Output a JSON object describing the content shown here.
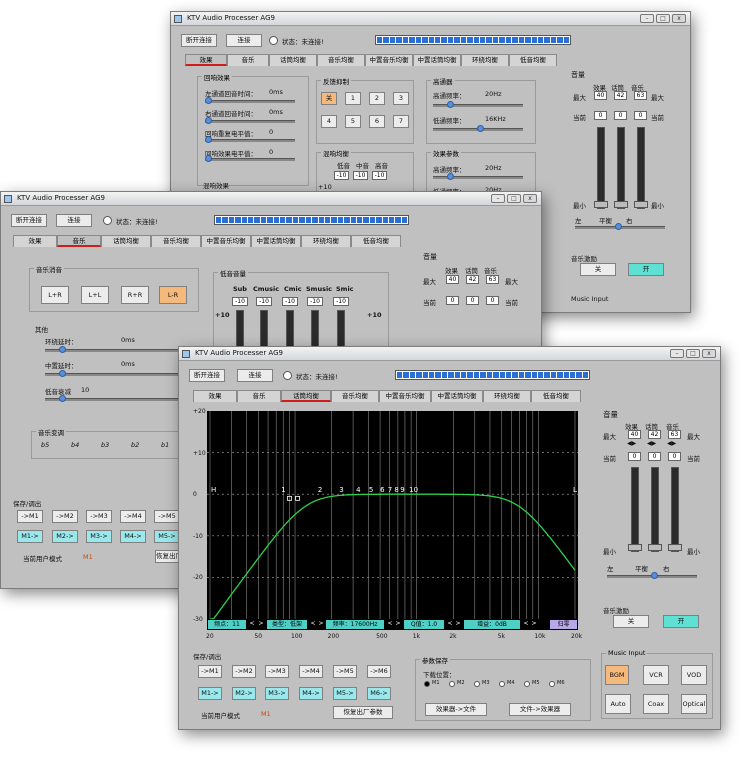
{
  "app_title": "KTV Audio Processer AG9",
  "win_buttons": {
    "min": "–",
    "max": "□",
    "close": "x"
  },
  "disconnect_label": "断开连接",
  "connect_label": "连接",
  "status_text": "状态：未连接!",
  "tabs": [
    "效果",
    "音乐",
    "话筒均衡",
    "音乐均衡",
    "中置音乐均衡",
    "中置话筒均衡",
    "环绕均衡",
    "低音均衡"
  ],
  "volume": {
    "title": "音量",
    "cols": [
      "效果",
      "话筒",
      "音乐"
    ],
    "max": "最大",
    "min": "最小",
    "current": "当前",
    "values": [
      "40",
      "42",
      "63"
    ],
    "current_values": [
      "0",
      "0",
      "0"
    ],
    "left": "左",
    "balance": "平衡",
    "right": "右"
  },
  "excitation": {
    "title": "音乐激励",
    "off": "关",
    "on": "开"
  },
  "music_input": {
    "title": "Music Input",
    "buttons": [
      "BGM",
      "VCR",
      "VOD",
      "Auto",
      "Coax",
      "Optical"
    ]
  },
  "save": {
    "title": "保存/调出",
    "store": [
      "->M1",
      "->M2",
      "->M3",
      "->M4",
      "->M5",
      "->M6"
    ],
    "recall": [
      "M1->",
      "M2->",
      "M3->",
      "M4->",
      "M5->",
      "M6->"
    ],
    "mode_label": "当前用户模式",
    "mode_value": "M1",
    "reset": "恢复出厂参数"
  },
  "params": {
    "title": "参数保存",
    "download_label": "下载位置：",
    "slots": [
      "M1",
      "M2",
      "M3",
      "M4",
      "M5",
      "M6"
    ],
    "to_file": "效果器->文件",
    "from_file": "文件->效果器"
  },
  "eq": {
    "y_ticks": [
      "+20",
      "+10",
      "0",
      "-10",
      "-20",
      "-30"
    ],
    "x_ticks": [
      "20",
      "50",
      "100",
      "200",
      "500",
      "1k",
      "2k",
      "5k",
      "10k",
      "20k"
    ],
    "node_labels": [
      "H",
      "1",
      "2",
      "3",
      "4",
      "5",
      "6",
      "7",
      "8",
      "9",
      "10",
      "L"
    ],
    "freq_point": "频点：11",
    "type": "类型：低架",
    "freq": "频率：17600Hz",
    "q": "Q值：1.0",
    "gain": "增益：0dB",
    "reset": "归零"
  },
  "effects": {
    "echo_title": "回响效果",
    "left_delay": "左通道回音时间：",
    "left_delay_val": "0ms",
    "right_delay": "右通道回音时间：",
    "right_delay_val": "0ms",
    "echo_rep": "回响重复电平值：",
    "echo_rep_val": "0",
    "echo_level": "回响效果电平值：",
    "echo_level_val": "0",
    "feedback_title": "反馈抑制",
    "fb_buttons": [
      "关",
      "1",
      "2",
      "3",
      "4",
      "5",
      "6",
      "7"
    ],
    "hp_title": "高通器",
    "hp_freq": "高通频率：",
    "hp_val": "20Hz",
    "lp_freq": "低通频率：",
    "lp_val": "16KHz",
    "mix_title": "混响均衡",
    "mix_cols": [
      "低音",
      "中音",
      "高音"
    ],
    "mix_vals": [
      "-10",
      "-10",
      "-10"
    ],
    "reverb_title": "混响效果",
    "eff_params": "效果参数",
    "hp2_val": "20Hz",
    "lp2_val": "20Hz"
  },
  "music": {
    "vocal_cancel": "音乐消音",
    "lr_buttons": [
      "L+R",
      "L+L",
      "R+R",
      "L-R"
    ],
    "other": "其他",
    "surround_delay": "环绕延时：",
    "surround_val": "0ms",
    "center_delay": "中置延时：",
    "center_val": "0ms",
    "bass_attn": "低音衰减",
    "bass_attn_val": "10",
    "key_title": "音乐变调",
    "keys": [
      "b5",
      "b4",
      "b3",
      "b2",
      "b1"
    ],
    "bass_vol": "低音音量",
    "bass_cols": [
      "Sub",
      "Cmusic",
      "Cmic",
      "Smusic",
      "Smic"
    ],
    "bass_vals": [
      "-10",
      "-10",
      "-10",
      "-10",
      "-10"
    ],
    "plus10": "+10"
  }
}
